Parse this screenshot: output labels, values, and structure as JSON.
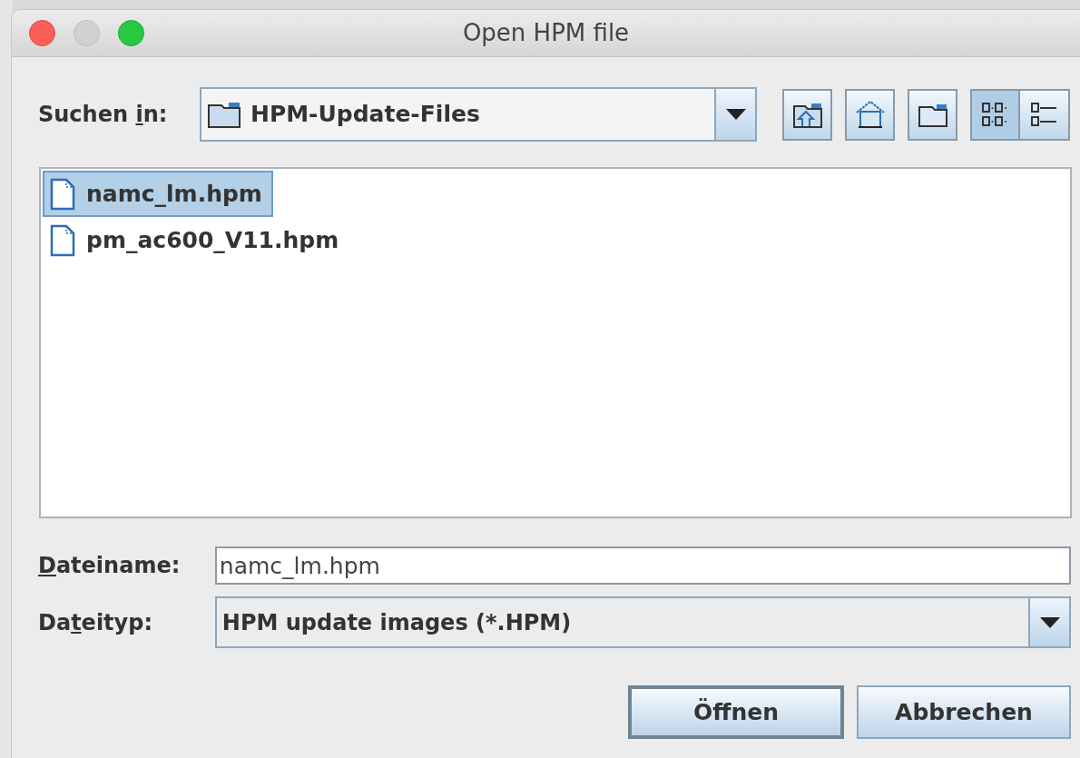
{
  "window": {
    "title": "Open HPM file",
    "controls": [
      {
        "kind": "close",
        "disabled": false
      },
      {
        "kind": "minimize",
        "disabled": true
      },
      {
        "kind": "zoom",
        "disabled": false
      }
    ]
  },
  "look_in": {
    "label": {
      "pre": "Suchen ",
      "key": "i",
      "post": "n:"
    },
    "value": "HPM-Update-Files"
  },
  "toolbar": [
    {
      "kind": "up",
      "selected": false
    },
    {
      "kind": "home",
      "selected": false
    },
    {
      "kind": "new-folder",
      "selected": false
    },
    {
      "kind": "list-view",
      "selected": true
    },
    {
      "kind": "details-view",
      "selected": false
    }
  ],
  "files": [
    {
      "name": "namc_lm.hpm",
      "selected": true
    },
    {
      "name": "pm_ac600_V11.hpm",
      "selected": false
    }
  ],
  "file_name": {
    "label": {
      "key": "D",
      "post": "ateiname:"
    },
    "value": "namc_lm.hpm"
  },
  "file_type": {
    "label": {
      "pre": "Da",
      "key": "t",
      "post": "eityp:"
    },
    "value": "HPM update images (*.HPM)"
  },
  "buttons": [
    {
      "label": "Öffnen",
      "default": true
    },
    {
      "label": "Abbrechen",
      "default": false
    }
  ]
}
